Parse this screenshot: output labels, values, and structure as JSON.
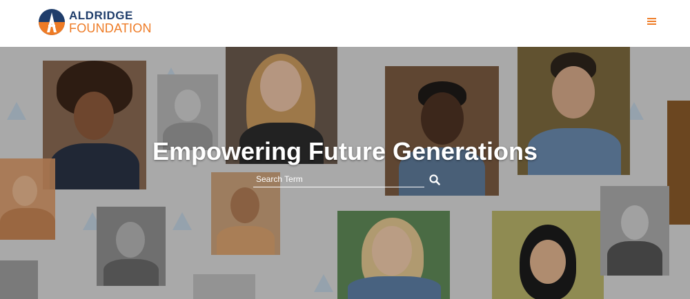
{
  "header": {
    "logo": {
      "line1": "ALDRIDGE",
      "line2": "FOUNDATION",
      "colors": {
        "navy": "#1f3d6b",
        "orange": "#ee7b25"
      }
    },
    "menu_icon": "hamburger-menu-icon"
  },
  "hero": {
    "title": "Empowering Future Generations",
    "search": {
      "placeholder": "Search Term",
      "value": "",
      "icon": "search-icon"
    }
  }
}
